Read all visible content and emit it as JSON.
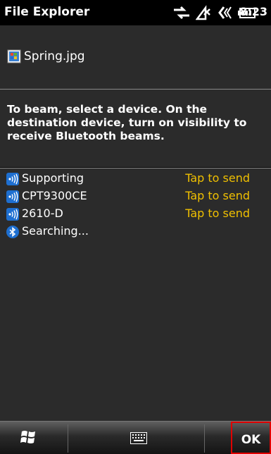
{
  "status_bar": {
    "app_title": "File Explorer",
    "clock": "8:23",
    "icons": [
      "data-sync-icon",
      "no-signal-icon",
      "volume-icon",
      "battery-icon"
    ]
  },
  "file": {
    "name": "Spring.jpg",
    "icon": "image-file-icon"
  },
  "instructions": "To beam, select a device. On the destination device, turn on visibility to receive Bluetooth beams.",
  "devices": [
    {
      "name": "Supporting",
      "action": "Tap to send",
      "icon": "beam-device-icon"
    },
    {
      "name": "CPT9300CE",
      "action": "Tap to send",
      "icon": "beam-device-icon"
    },
    {
      "name": "2610-D",
      "action": "Tap to send",
      "icon": "beam-device-icon"
    }
  ],
  "searching": {
    "label": "Searching...",
    "icon": "bluetooth-icon"
  },
  "softkeys": {
    "start": "windows-start-icon",
    "keyboard": "keyboard-icon",
    "ok_label": "OK"
  },
  "colors": {
    "background": "#000000",
    "panel": "#2b2b2b",
    "action_text": "#f0c000",
    "highlight_border": "#e00000"
  }
}
